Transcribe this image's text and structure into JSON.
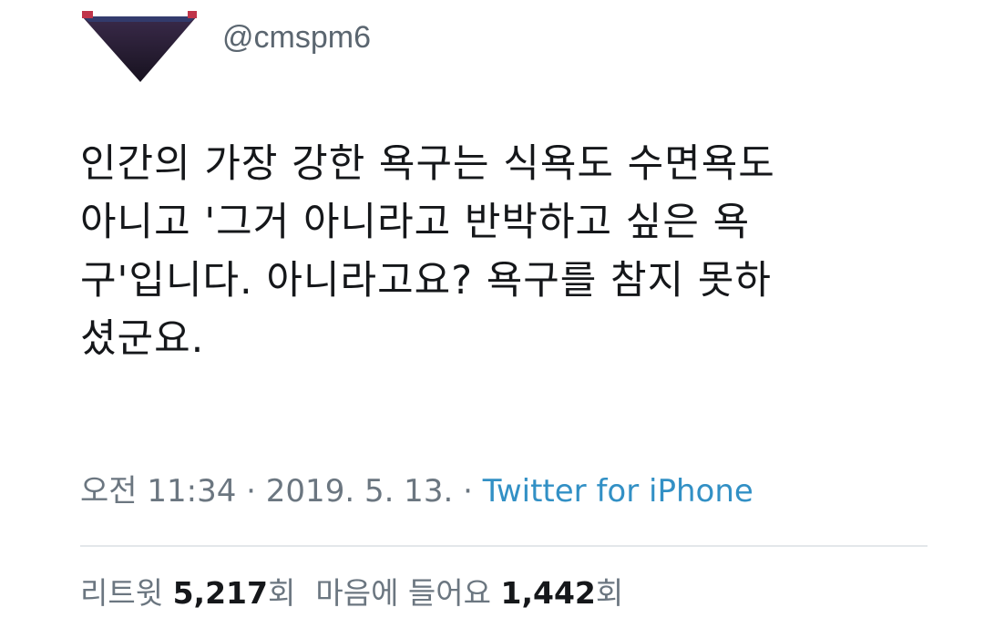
{
  "author": {
    "handle": "@cmspm6"
  },
  "tweet": {
    "lines": [
      "인간의 가장 강한 욕구는 식욕도 수면욕도",
      "아니고 '그거 아니라고 반박하고 싶은 욕",
      "구'입니다. 아니라고요? 욕구를 참지 못하",
      "셨군요."
    ]
  },
  "meta": {
    "time": "오전 11:34",
    "separator": "·",
    "date": "2019. 5. 13.",
    "source": "Twitter for iPhone"
  },
  "stats": {
    "retweet_label": "리트윗",
    "retweet_count": "5,217",
    "retweet_suffix": "회",
    "like_label": "마음에 들어요",
    "like_count": "1,442",
    "like_suffix": "회"
  },
  "colors": {
    "text": "#15171a",
    "secondary": "#6b7680",
    "link": "#3290c5"
  }
}
